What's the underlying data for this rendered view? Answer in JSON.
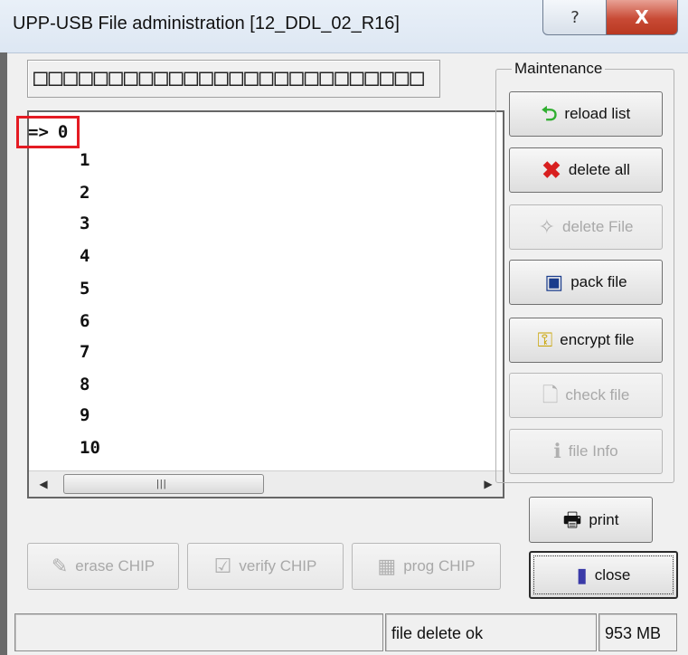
{
  "window": {
    "title": "UPP-USB File administration [12_DDL_02_R16]",
    "help_glyph": "?",
    "close_glyph": "X"
  },
  "filename_box": {
    "text": "□□□□□□□□□□□□□□□□□□□□□□□□□□"
  },
  "file_list": {
    "selected_marker": "=>",
    "items": [
      "0",
      "1",
      "2",
      "3",
      "4",
      "5",
      "6",
      "7",
      "8",
      "9",
      "10"
    ],
    "selected_index": 0
  },
  "maintenance": {
    "group_label": "Maintenance",
    "buttons": {
      "reload_list": "reload list",
      "delete_all": "delete all",
      "delete_file": "delete File",
      "pack_file": "pack file",
      "encrypt_file": "encrypt file",
      "check_file": "check file",
      "file_info": "file Info"
    }
  },
  "actions": {
    "print": "print",
    "close": "close",
    "erase_chip": "erase CHIP",
    "verify_chip": "verify CHIP",
    "prog_chip": "prog CHIP"
  },
  "status": {
    "panel1": "",
    "message": "file delete ok",
    "free_space": "953 MB"
  },
  "colors": {
    "selection_highlight": "#e41b23",
    "close_button_red": "#c84a35",
    "reload_arrow_green": "#2fae2f",
    "delete_all_red": "#d81f1f"
  },
  "icons": {
    "reload": "green-return-arrow-icon",
    "delete_all": "red-x-icon",
    "delete_file": "eraser-sparkle-icon",
    "pack": "floppy-pack-icon",
    "encrypt": "keys-icon",
    "check": "document-icon",
    "info": "info-icon",
    "print": "printer-icon",
    "close": "door-icon",
    "erase": "eraser-icon",
    "verify": "checklist-icon",
    "prog": "chip-icon"
  }
}
